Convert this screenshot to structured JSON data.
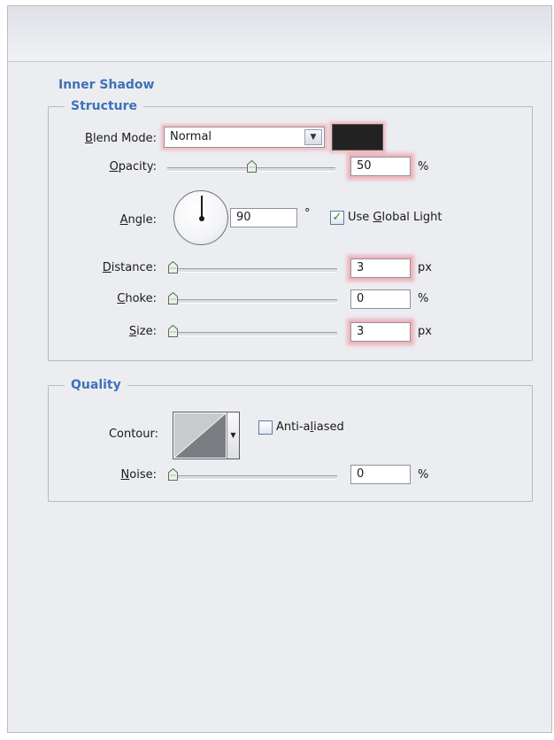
{
  "inner_shadow": {
    "title": "Inner Shadow",
    "structure": {
      "title": "Structure",
      "blend_mode_label": "lend Mode:",
      "blend_mode_label_mnemonic": "B",
      "blend_mode_value": "Normal",
      "blend_color": "#222222",
      "opacity_label": "pacity:",
      "opacity_label_mnemonic": "O",
      "opacity_value": "50",
      "opacity_unit": "%",
      "opacity_fraction": 0.5,
      "angle_label": "ngle:",
      "angle_label_mnemonic": "A",
      "angle_value": "90",
      "angle_unit": "°",
      "global_light_label_pre": "Use ",
      "global_light_label_mnemonic": "G",
      "global_light_label_post": "lobal Light",
      "global_light_checked": true,
      "distance_label": "istance:",
      "distance_label_mnemonic": "D",
      "distance_value": "3",
      "distance_unit": "px",
      "distance_fraction": 0.0,
      "choke_label": "hoke:",
      "choke_label_mnemonic": "C",
      "choke_value": "0",
      "choke_unit": "%",
      "choke_fraction": 0.0,
      "size_label": "ize:",
      "size_label_mnemonic": "S",
      "size_value": "3",
      "size_unit": "px",
      "size_fraction": 0.0
    },
    "quality": {
      "title": "Quality",
      "contour_label": "Contour:",
      "anti_aliased_label_pre": "Anti-a",
      "anti_aliased_label_mnemonic": "l",
      "anti_aliased_label_post": "iased",
      "anti_aliased_checked": false,
      "noise_label": "oise:",
      "noise_label_mnemonic": "N",
      "noise_value": "0",
      "noise_unit": "%",
      "noise_fraction": 0.0
    }
  },
  "icons": {
    "dropdown": "chevron-down-icon",
    "slider_thumb": "slider-thumb-icon",
    "check": "checkmark-icon"
  },
  "colors": {
    "accent": "#3d72b8",
    "highlight": "#e86e7a"
  }
}
